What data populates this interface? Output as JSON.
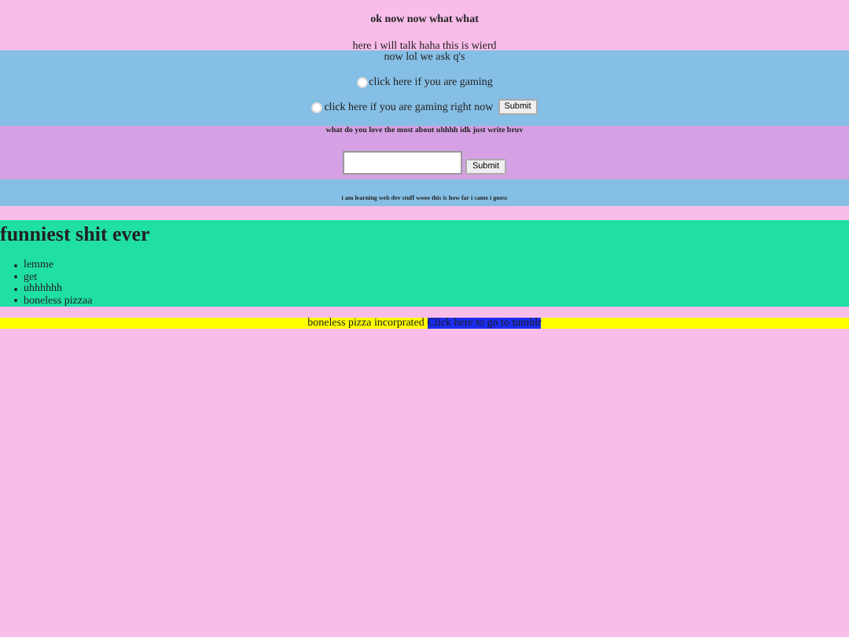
{
  "header": {
    "title": "ok now now what what",
    "text": "here i will talk haha this is wierd"
  },
  "quiz": {
    "prompt": "now lol we ask q's",
    "options": [
      {
        "label": "click here if you are gaming",
        "selected": false
      },
      {
        "label": "click here if you are gaming right now",
        "selected": false
      }
    ],
    "submit": "Submit"
  },
  "question": {
    "prompt": "what do you love the most about uhhhh idk just write bruv",
    "submit": "Submit"
  },
  "note": "i am learning web dev stuff wooo this is how far i came i guess",
  "list_section": {
    "title": "funniest shit ever",
    "items": [
      "lemme",
      "get",
      "uhhhhhh",
      "boneless pizzaa"
    ]
  },
  "footer": {
    "text": "boneless pizza incorprated",
    "link": "Click here to go to tumblr"
  }
}
